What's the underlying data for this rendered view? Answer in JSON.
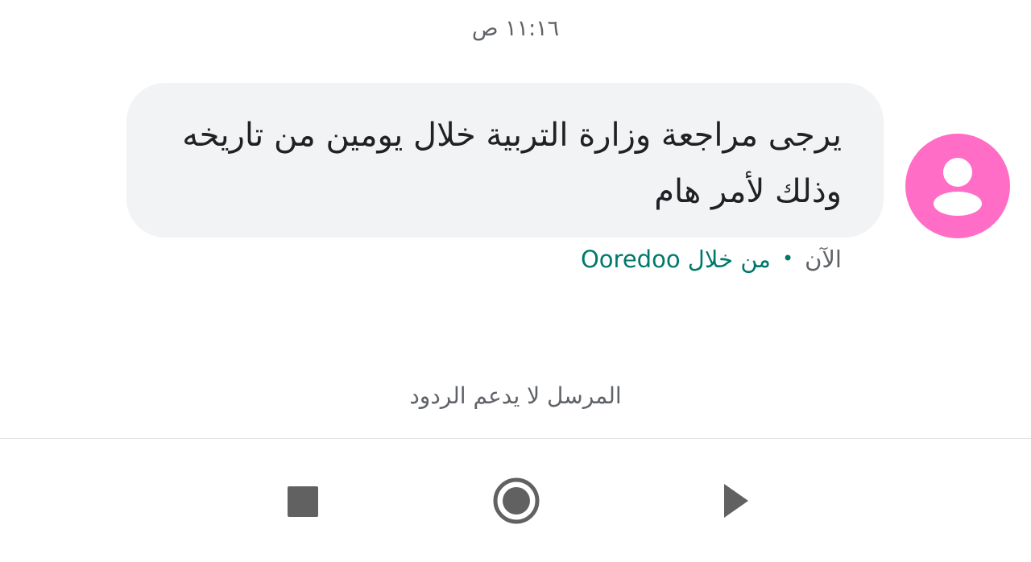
{
  "conversation": {
    "timestamp": "١١:١٦ ص",
    "message": {
      "text": "يرجى مراجعة وزارة التربية خلال يومين من تاريخه وذلك لأمر هام",
      "status_time": "الآن",
      "via_label": "من خلال Ooredoo"
    },
    "sender_avatar_icon": "person-icon",
    "no_reply_notice": "المرسل لا يدعم الردود"
  },
  "nav_bar": {
    "icons": [
      "recents-square-icon",
      "home-circle-icon",
      "back-triangle-icon"
    ]
  },
  "colors": {
    "avatar_bg": "#ff6dc6",
    "bubble_bg": "#f1f3f4",
    "accent": "#00796b",
    "muted_text": "#5f6368"
  }
}
